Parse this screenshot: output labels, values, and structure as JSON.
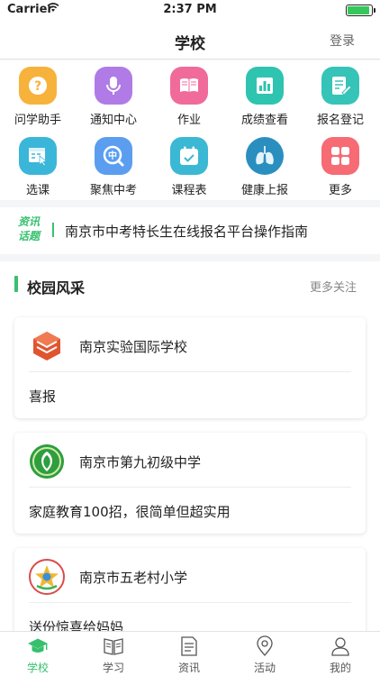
{
  "status_bar": {
    "carrier": "Carrier",
    "time": "2:37 PM"
  },
  "nav": {
    "title": "学校",
    "login": "登录"
  },
  "grid": [
    {
      "label": "问学助手",
      "icon": "question-icon",
      "color": "#f7b23b"
    },
    {
      "label": "通知中心",
      "icon": "microphone-icon",
      "color": "#b07be6"
    },
    {
      "label": "作业",
      "icon": "book-icon",
      "color": "#f06a9a"
    },
    {
      "label": "成绩查看",
      "icon": "bar-chart-icon",
      "color": "#2fc4b0"
    },
    {
      "label": "报名登记",
      "icon": "form-edit-icon",
      "color": "#36c3b8"
    },
    {
      "label": "选课",
      "icon": "select-course-icon",
      "color": "#3ab6d9"
    },
    {
      "label": "聚焦中考",
      "icon": "focus-exam-icon",
      "color": "#5b9ef0"
    },
    {
      "label": "课程表",
      "icon": "calendar-icon",
      "color": "#3bb8d4"
    },
    {
      "label": "健康上报",
      "icon": "lungs-icon",
      "color": "#2a8fbf"
    },
    {
      "label": "更多",
      "icon": "grid-more-icon",
      "color": "#f66b74"
    }
  ],
  "news": {
    "badge_line1": "资讯",
    "badge_line2": "话题",
    "headline": "南京市中考特长生在线报名平台操作指南",
    "accent": "#37c06e"
  },
  "campus": {
    "title": "校园风采",
    "more": "更多关注"
  },
  "cards": [
    {
      "school": "南京实验国际学校",
      "post": "喜报",
      "logo": "cube-logo"
    },
    {
      "school": "南京市第九初级中学",
      "post": "家庭教育100招，很简单但超实用",
      "logo": "green-emblem-logo"
    },
    {
      "school": "南京市五老村小学",
      "post": "送份惊喜给妈妈",
      "logo": "star-emblem-logo"
    }
  ],
  "tabs": [
    {
      "label": "学校",
      "icon": "school-cap-icon",
      "active": true
    },
    {
      "label": "学习",
      "icon": "open-book-icon",
      "active": false
    },
    {
      "label": "资讯",
      "icon": "news-icon",
      "active": false
    },
    {
      "label": "活动",
      "icon": "location-pin-icon",
      "active": false
    },
    {
      "label": "我的",
      "icon": "person-icon",
      "active": false
    }
  ]
}
